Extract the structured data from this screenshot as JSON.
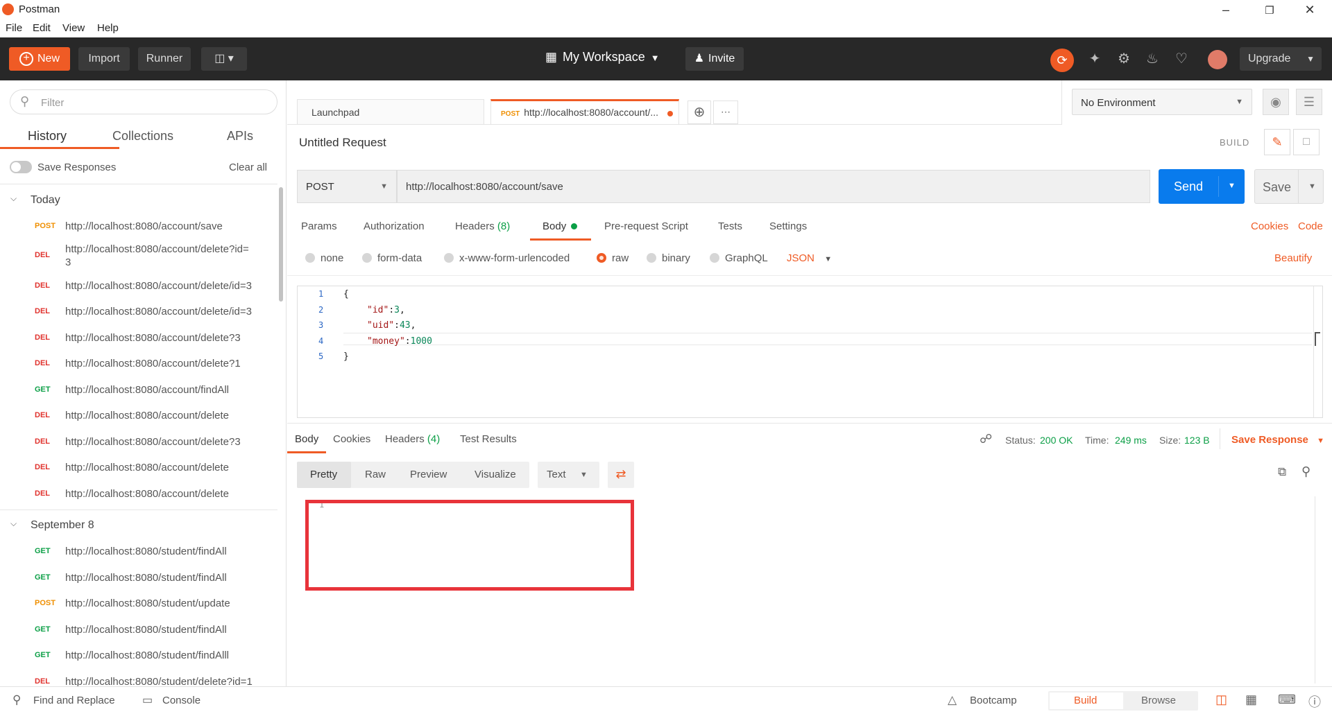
{
  "window": {
    "title": "Postman"
  },
  "menu": [
    "File",
    "Edit",
    "View",
    "Help"
  ],
  "header": {
    "new_label": "New",
    "import_label": "Import",
    "runner_label": "Runner",
    "workspace_label": "My Workspace",
    "invite_label": "Invite",
    "upgrade_label": "Upgrade"
  },
  "sidebar": {
    "filter_placeholder": "Filter",
    "tabs": [
      "History",
      "Collections",
      "APIs"
    ],
    "save_responses_label": "Save Responses",
    "clear_all_label": "Clear all",
    "groups": [
      {
        "label": "Today",
        "items": [
          {
            "method": "POST",
            "url": "http://localhost:8080/account/save"
          },
          {
            "method": "DEL",
            "url": "http://localhost:8080/account/delete?id=\n3"
          },
          {
            "method": "DEL",
            "url": "http://localhost:8080/account/delete/id=3"
          },
          {
            "method": "DEL",
            "url": "http://localhost:8080/account/delete/id=3"
          },
          {
            "method": "DEL",
            "url": "http://localhost:8080/account/delete?3"
          },
          {
            "method": "DEL",
            "url": "http://localhost:8080/account/delete?1"
          },
          {
            "method": "GET",
            "url": "http://localhost:8080/account/findAll"
          },
          {
            "method": "DEL",
            "url": "http://localhost:8080/account/delete"
          },
          {
            "method": "DEL",
            "url": "http://localhost:8080/account/delete?3"
          },
          {
            "method": "DEL",
            "url": "http://localhost:8080/account/delete"
          },
          {
            "method": "DEL",
            "url": "http://localhost:8080/account/delete"
          }
        ]
      },
      {
        "label": "September 8",
        "items": [
          {
            "method": "GET",
            "url": "http://localhost:8080/student/findAll"
          },
          {
            "method": "GET",
            "url": "http://localhost:8080/student/findAll"
          },
          {
            "method": "POST",
            "url": "http://localhost:8080/student/update"
          },
          {
            "method": "GET",
            "url": "http://localhost:8080/student/findAll"
          },
          {
            "method": "GET",
            "url": "http://localhost:8080/student/findAlll"
          },
          {
            "method": "DEL",
            "url": "http://localhost:8080/student/delete?id=1"
          }
        ]
      }
    ]
  },
  "tabs": {
    "launchpad": "Launchpad",
    "active_method": "POST",
    "active_url": "http://localhost:8080/account/..."
  },
  "environment": {
    "selected": "No Environment"
  },
  "request": {
    "name": "Untitled Request",
    "build_label": "BUILD",
    "method": "POST",
    "url": "http://localhost:8080/account/save",
    "send_label": "Send",
    "save_label": "Save",
    "subtabs": [
      "Params",
      "Authorization",
      "Headers",
      "Body",
      "Pre-request Script",
      "Tests",
      "Settings"
    ],
    "headers_count": "(8)",
    "cookies_label": "Cookies",
    "code_label": "Code",
    "body_types": [
      "none",
      "form-data",
      "x-www-form-urlencoded",
      "raw",
      "binary",
      "GraphQL"
    ],
    "body_format": "JSON",
    "beautify_label": "Beautify",
    "line_numbers": [
      "1",
      "2",
      "3",
      "4",
      "5"
    ],
    "code_lines": [
      "{",
      "\"id\":3,",
      "\"uid\":43,",
      "\"money\":1000",
      "}"
    ]
  },
  "response": {
    "tabs": [
      "Body",
      "Cookies",
      "Headers",
      "Test Results"
    ],
    "headers_count": "(4)",
    "status_label": "Status:",
    "status_value": "200 OK",
    "time_label": "Time:",
    "time_value": "249 ms",
    "size_label": "Size:",
    "size_value": "123 B",
    "save_response_label": "Save Response",
    "view_modes": [
      "Pretty",
      "Raw",
      "Preview",
      "Visualize"
    ],
    "format": "Text",
    "line_number": "1"
  },
  "statusbar": {
    "find_replace": "Find and Replace",
    "console": "Console",
    "bootcamp": "Bootcamp",
    "build": "Build",
    "browse": "Browse"
  },
  "colors": {
    "accent": "#ef5b25",
    "send": "#097bed",
    "success": "#0b9f46",
    "highlight_box": "#e8333a"
  }
}
